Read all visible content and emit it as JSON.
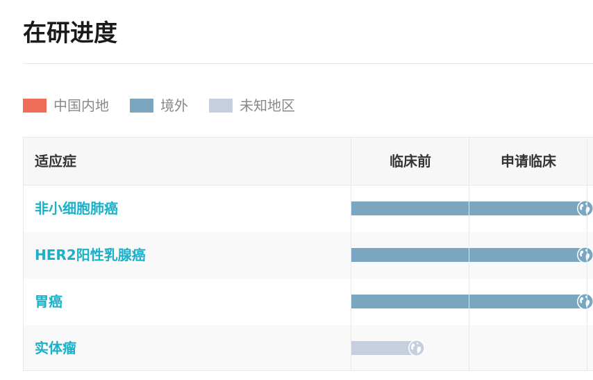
{
  "header": {
    "title": "在研进度"
  },
  "legend": {
    "items": [
      {
        "label": "中国内地",
        "color": "#ee6e5a"
      },
      {
        "label": "境外",
        "color": "#7aa7bf"
      },
      {
        "label": "未知地区",
        "color": "#c5cfdd"
      }
    ]
  },
  "table": {
    "columns": {
      "indication": "适应症",
      "stages": [
        "临床前",
        "申请临床"
      ]
    },
    "rows": [
      {
        "indication": "非小细胞肺癌",
        "region": "境外",
        "progress_stages": 2,
        "icon": "globe-icon"
      },
      {
        "indication": "HER2阳性乳腺癌",
        "region": "境外",
        "progress_stages": 2,
        "icon": "globe-icon"
      },
      {
        "indication": "胃癌",
        "region": "境外",
        "progress_stages": 2,
        "icon": "globe-icon"
      },
      {
        "indication": "实体瘤",
        "region": "未知地区",
        "progress_stages": 0.55,
        "icon": "globe-icon"
      }
    ]
  }
}
